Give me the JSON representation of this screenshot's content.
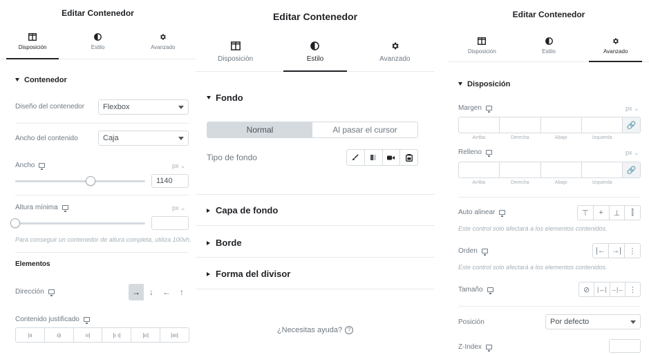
{
  "panel1": {
    "title": "Editar Contenedor",
    "tabs": [
      {
        "label": "Disposición",
        "icon": "layout-icon"
      },
      {
        "label": "Estilo",
        "icon": "contrast-icon"
      },
      {
        "label": "Avanzado",
        "icon": "gear-icon"
      }
    ],
    "section_title": "Contenedor",
    "container_design_label": "Diseño del contenedor",
    "container_design_value": "Flexbox",
    "content_width_label": "Ancho del contenido",
    "content_width_value": "Caja",
    "width_label": "Ancho",
    "width_unit": "px",
    "width_value": "1140",
    "min_height_label": "Altura mínima",
    "min_height_unit": "px",
    "min_height_value": "",
    "hint": "Para conseguir un contenedor de altura completa, utiliza 100vh.",
    "elements_title": "Elementos",
    "direction_label": "Dirección",
    "direction_buttons": [
      "→",
      "↓",
      "←",
      "↑"
    ],
    "justify_label": "Contenido justificado",
    "justify_buttons": [
      "|ıı",
      "ı|ı",
      "ıı|",
      "|ı ı|",
      "|ıı|",
      "|ııı|"
    ]
  },
  "panel2": {
    "title": "Editar Contenedor",
    "tabs": [
      {
        "label": "Disposición",
        "icon": "layout-icon"
      },
      {
        "label": "Estilo",
        "icon": "contrast-icon"
      },
      {
        "label": "Avanzado",
        "icon": "gear-icon"
      }
    ],
    "background_title": "Fondo",
    "state_normal": "Normal",
    "state_hover": "Al pasar el cursor",
    "background_type_label": "Tipo de fondo",
    "bg_type_icons": [
      "brush-icon",
      "gradient-icon",
      "video-icon",
      "slideshow-icon"
    ],
    "accordions": [
      "Capa de fondo",
      "Borde",
      "Forma del divisor"
    ],
    "help_text": "¿Necesitas ayuda?",
    "help_icon_glyph": "?"
  },
  "panel3": {
    "title": "Editar Contenedor",
    "tabs": [
      {
        "label": "Disposición",
        "icon": "layout-icon"
      },
      {
        "label": "Estilo",
        "icon": "contrast-icon"
      },
      {
        "label": "Avanzado",
        "icon": "gear-icon"
      }
    ],
    "section_title": "Disposición",
    "margin_label": "Margen",
    "padding_label": "Relleno",
    "unit": "px",
    "dimension_labels": [
      "Arriba",
      "Derecha",
      "Abajo",
      "Izquierda"
    ],
    "link_glyph": "🔗",
    "align_self_label": "Auto alinear",
    "align_buttons": [
      "⊤",
      "+",
      "⊥",
      "⫿"
    ],
    "align_hint": "Este control solo afectará a los elementos contenidos.",
    "order_label": "Orden",
    "order_buttons": [
      "|←",
      "→|",
      "⋮"
    ],
    "order_hint": "Este control solo afectará a los elementos contenidos.",
    "size_label": "Tamaño",
    "size_buttons": [
      "⊘",
      "|↔|",
      "→|←",
      "⋮"
    ],
    "position_label": "Posición",
    "position_value": "Por defecto",
    "zindex_label": "Z-Index",
    "zindex_value": ""
  },
  "colors": {
    "text": "#3f444b",
    "muted": "#6d7882",
    "border": "#d5dadf",
    "active_tab": "#1f2124"
  }
}
